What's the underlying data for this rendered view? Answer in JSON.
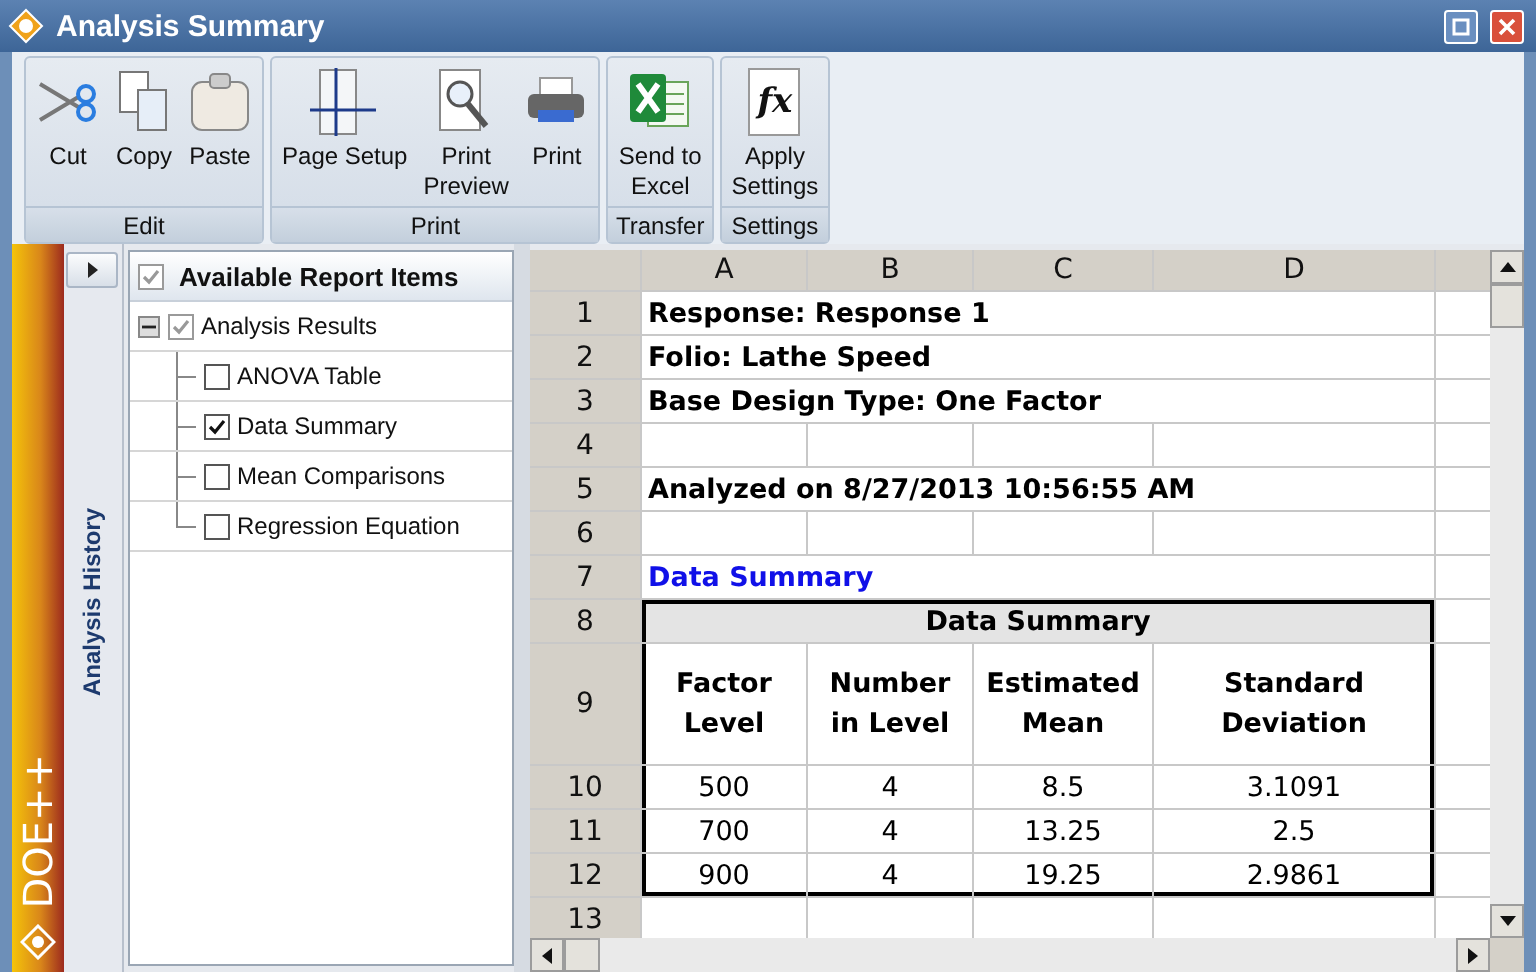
{
  "window": {
    "title": "Analysis Summary"
  },
  "ribbon": {
    "groups": [
      {
        "label": "Edit",
        "buttons": [
          {
            "kind": "cut",
            "label": "Cut"
          },
          {
            "kind": "copy",
            "label": "Copy"
          },
          {
            "kind": "paste",
            "label": "Paste"
          }
        ]
      },
      {
        "label": "Print",
        "buttons": [
          {
            "kind": "page-setup",
            "label": "Page Setup"
          },
          {
            "kind": "print-preview",
            "label": "Print\nPreview"
          },
          {
            "kind": "print",
            "label": "Print"
          }
        ]
      },
      {
        "label": "Transfer",
        "buttons": [
          {
            "kind": "excel",
            "label": "Send to\nExcel"
          }
        ]
      },
      {
        "label": "Settings",
        "buttons": [
          {
            "kind": "function",
            "label": "Apply\nSettings",
            "glyph": "fx"
          }
        ]
      }
    ]
  },
  "brand": {
    "name": "DOE++"
  },
  "history_panel": {
    "title": "Analysis History"
  },
  "report_items": {
    "title": "Available Report Items",
    "checked": true,
    "items": [
      {
        "label": "Analysis Results",
        "checked": true,
        "expanded": true,
        "children": [
          {
            "label": "ANOVA Table",
            "checked": false
          },
          {
            "label": "Data Summary",
            "checked": true
          },
          {
            "label": "Mean Comparisons",
            "checked": false
          },
          {
            "label": "Regression Equation",
            "checked": false
          }
        ]
      }
    ]
  },
  "sheet": {
    "columns": [
      "A",
      "B",
      "C",
      "D"
    ],
    "rows": [
      {
        "header": "1",
        "kind": "text",
        "text": "Response: Response 1"
      },
      {
        "header": "2",
        "kind": "text",
        "text": "Folio: Lathe Speed"
      },
      {
        "header": "3",
        "kind": "text",
        "text": "Base Design Type: One Factor"
      },
      {
        "header": "4",
        "kind": "blank"
      },
      {
        "header": "5",
        "kind": "text",
        "text": "Analyzed on 8/27/2013 10:56:55 AM"
      },
      {
        "header": "6",
        "kind": "blank"
      },
      {
        "header": "7",
        "kind": "heading",
        "text": "Data Summary"
      },
      {
        "header": "8",
        "kind": "table-title",
        "text": "Data Summary"
      },
      {
        "header": "9",
        "kind": "table-head",
        "cells": [
          "Factor Level",
          "Number in Level",
          "Estimated Mean",
          "Standard Deviation"
        ]
      },
      {
        "header": "10",
        "kind": "table-row",
        "cells": [
          "500",
          "4",
          "8.5",
          "3.1091"
        ]
      },
      {
        "header": "11",
        "kind": "table-row",
        "cells": [
          "700",
          "4",
          "13.25",
          "2.5"
        ]
      },
      {
        "header": "12",
        "kind": "table-row",
        "cells": [
          "900",
          "4",
          "19.25",
          "2.9861"
        ]
      },
      {
        "header": "13",
        "kind": "blank"
      }
    ]
  }
}
